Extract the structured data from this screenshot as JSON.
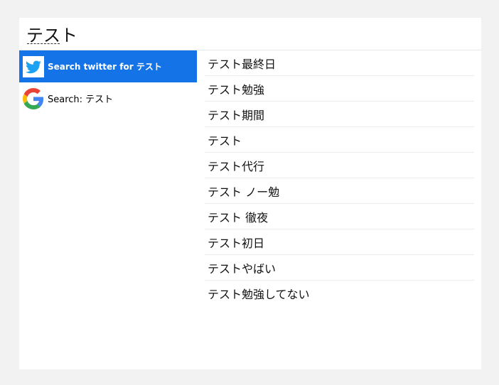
{
  "search": {
    "value": "テスト"
  },
  "actions": [
    {
      "icon": "twitter-icon",
      "label": "Search twitter for テスト",
      "selected": true
    },
    {
      "icon": "google-icon",
      "label": "Search: テスト",
      "selected": false
    }
  ],
  "suggestions": [
    "テスト最終日",
    "テスト勉強",
    "テスト期間",
    "テスト",
    "テスト代行",
    "テスト ノー勉",
    "テスト 徹夜",
    "テスト初日",
    "テストやばい",
    "テスト勉強してない"
  ],
  "colors": {
    "selected_bg": "#1473e6",
    "twitter_blue": "#1da1f2"
  }
}
